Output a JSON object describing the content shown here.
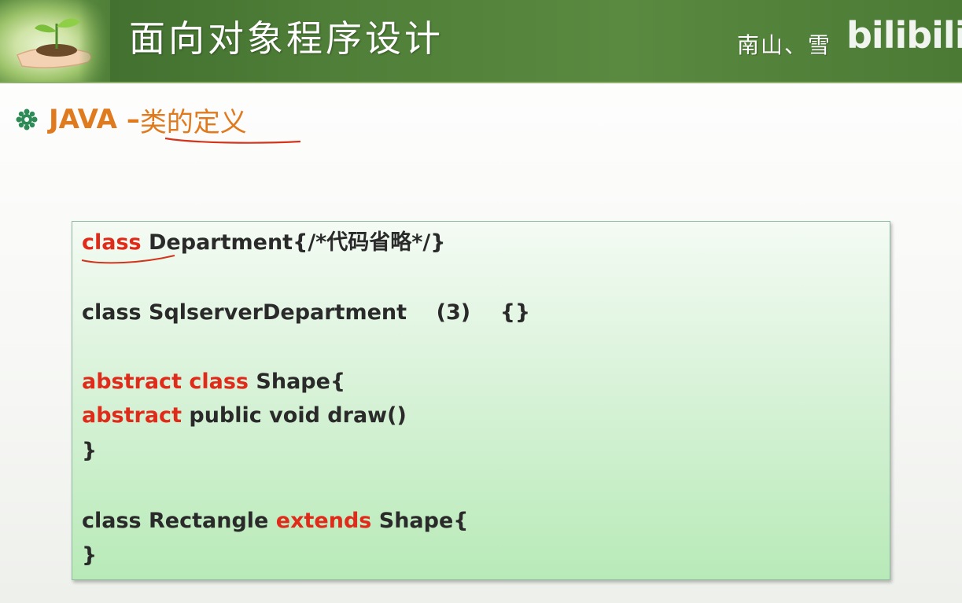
{
  "header": {
    "title": "面向对象程序设计",
    "author": "南山、雪",
    "logo": "bilibili",
    "banner_color": "#4f7f38"
  },
  "section": {
    "bullet_icon": "gear-flower-icon",
    "prefix": "JAVA – ",
    "topic": "类的定义",
    "accent_color": "#e07a1f"
  },
  "code": {
    "keyword_color": "#e02a1a",
    "lines": [
      {
        "kw": "class",
        "text": " Department{/*代码省略*/}"
      },
      {
        "text": "class SqlserverDepartment    (3)    {}"
      },
      {
        "kw": "abstract class",
        "text": " Shape{"
      },
      {
        "kw": "abstract",
        "text": " public void draw()"
      },
      {
        "text": "}"
      },
      {
        "pre": "class Rectangle ",
        "kw": "extends",
        "text": " Shape{"
      },
      {
        "text": "}"
      }
    ]
  }
}
